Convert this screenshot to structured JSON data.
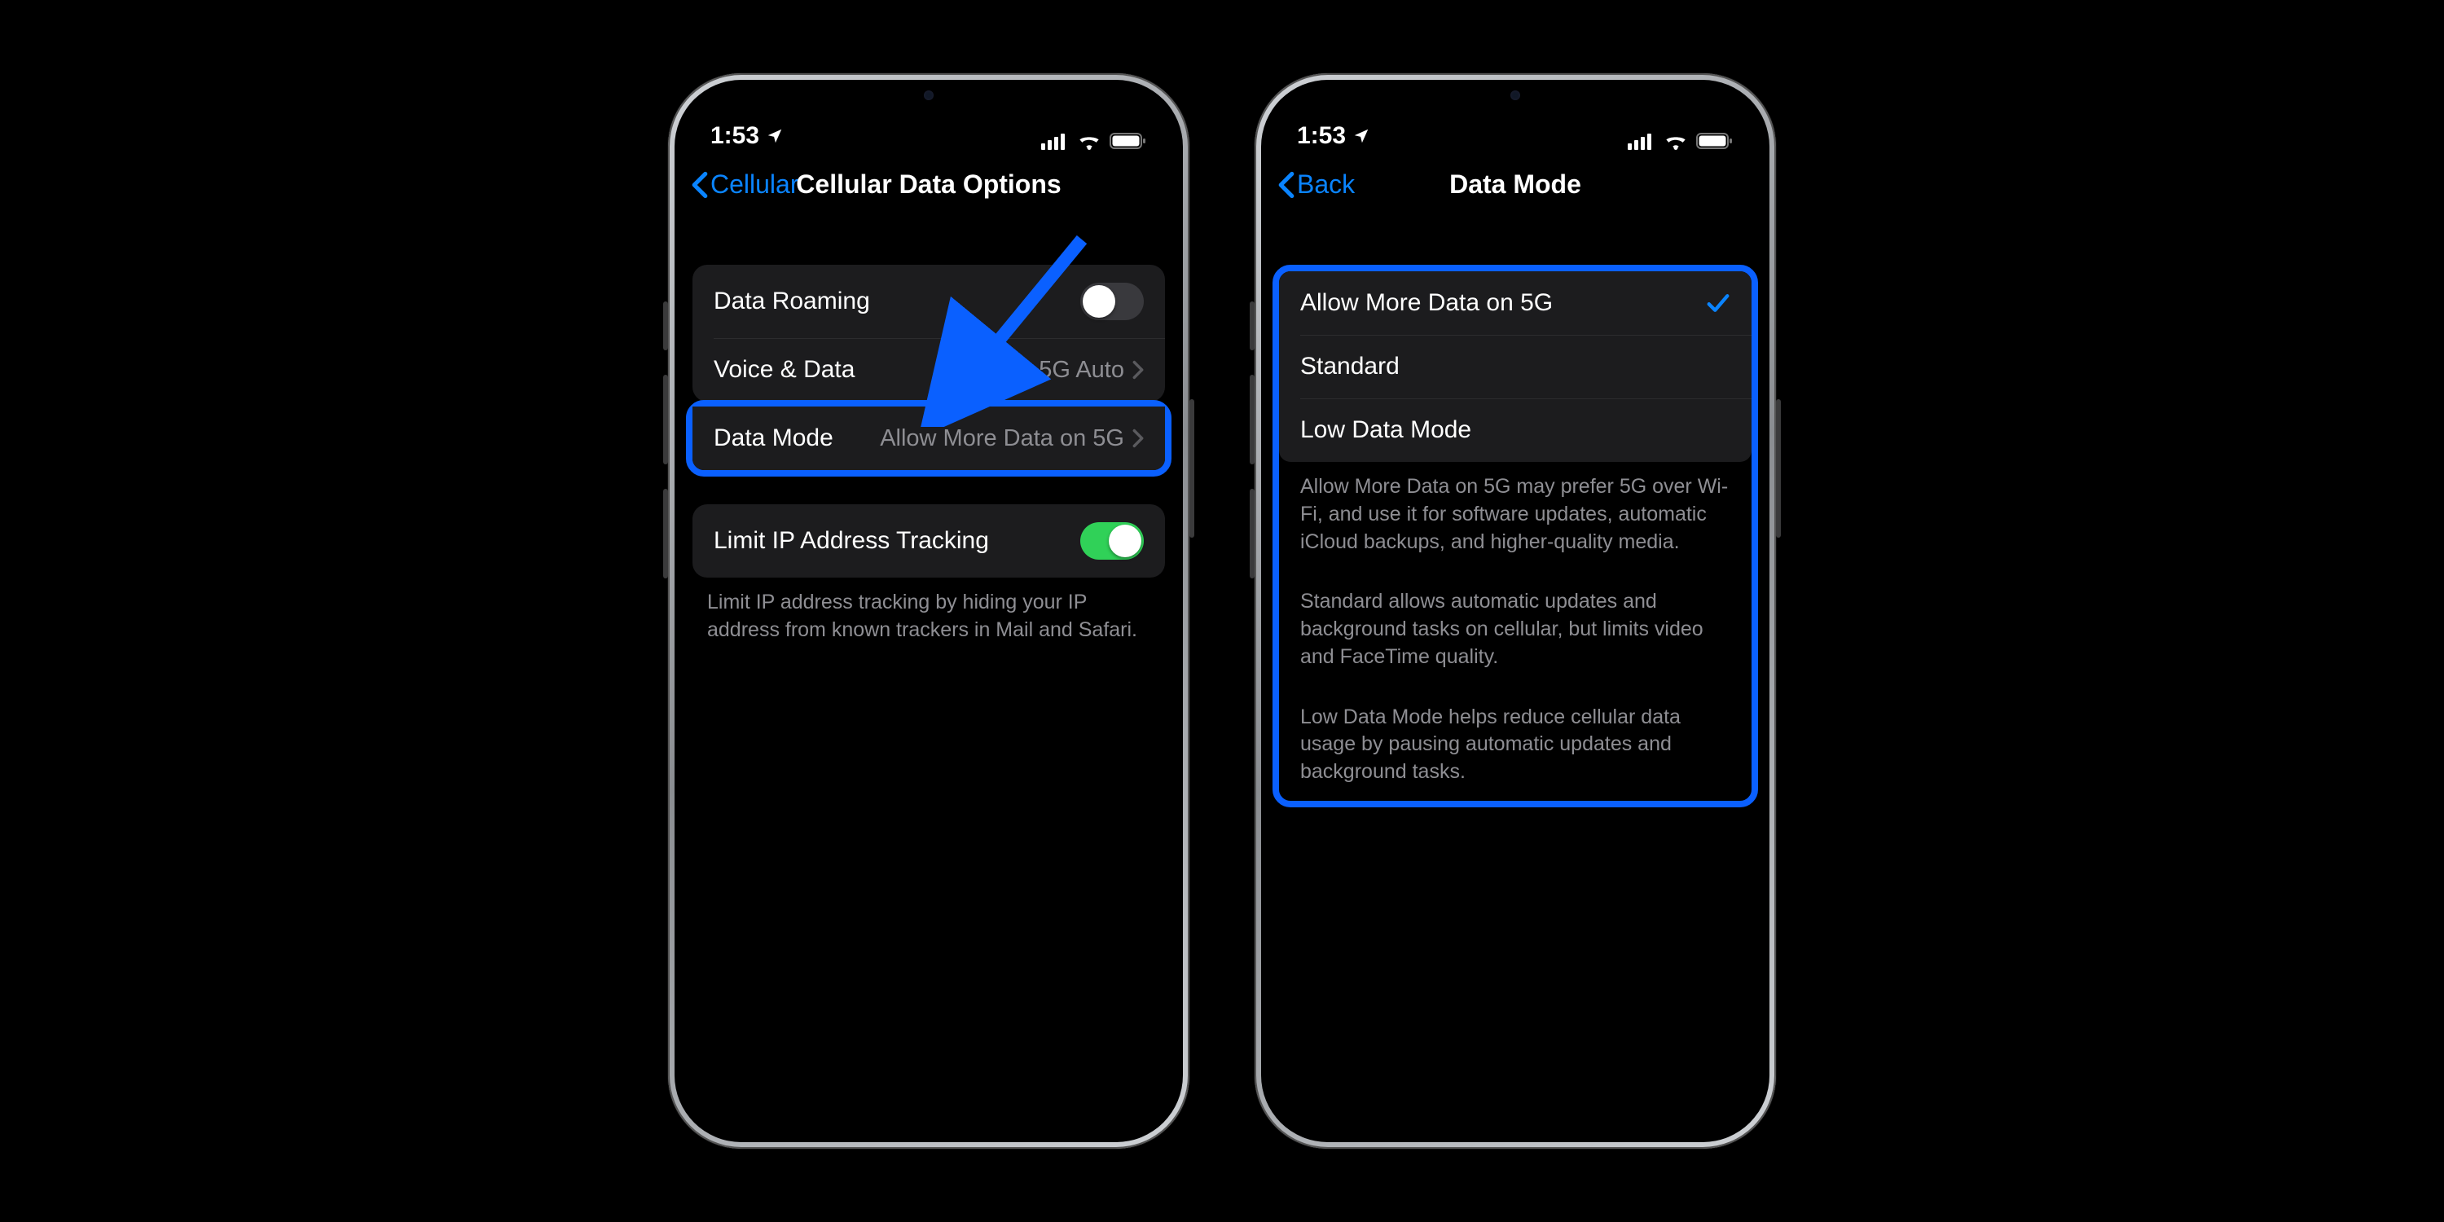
{
  "status": {
    "time": "1:53"
  },
  "left": {
    "back": "Cellular",
    "title": "Cellular Data Options",
    "rows": {
      "roaming": "Data Roaming",
      "voice": "Voice & Data",
      "voice_value": "5G Auto",
      "mode": "Data Mode",
      "mode_value": "Allow More Data on 5G",
      "limitIP": "Limit IP Address Tracking"
    },
    "footer": "Limit IP address tracking by hiding your IP address from known trackers in Mail and Safari."
  },
  "right": {
    "back": "Back",
    "title": "Data Mode",
    "options": {
      "opt1": "Allow More Data on 5G",
      "opt2": "Standard",
      "opt3": "Low Data Mode"
    },
    "desc1": "Allow More Data on 5G may prefer 5G over Wi-Fi, and use it for software updates, automatic iCloud backups, and higher-quality media.",
    "desc2": "Standard allows automatic updates and background tasks on cellular, but limits video and FaceTime quality.",
    "desc3": "Low Data Mode helps reduce cellular data usage by pausing automatic updates and background tasks."
  }
}
